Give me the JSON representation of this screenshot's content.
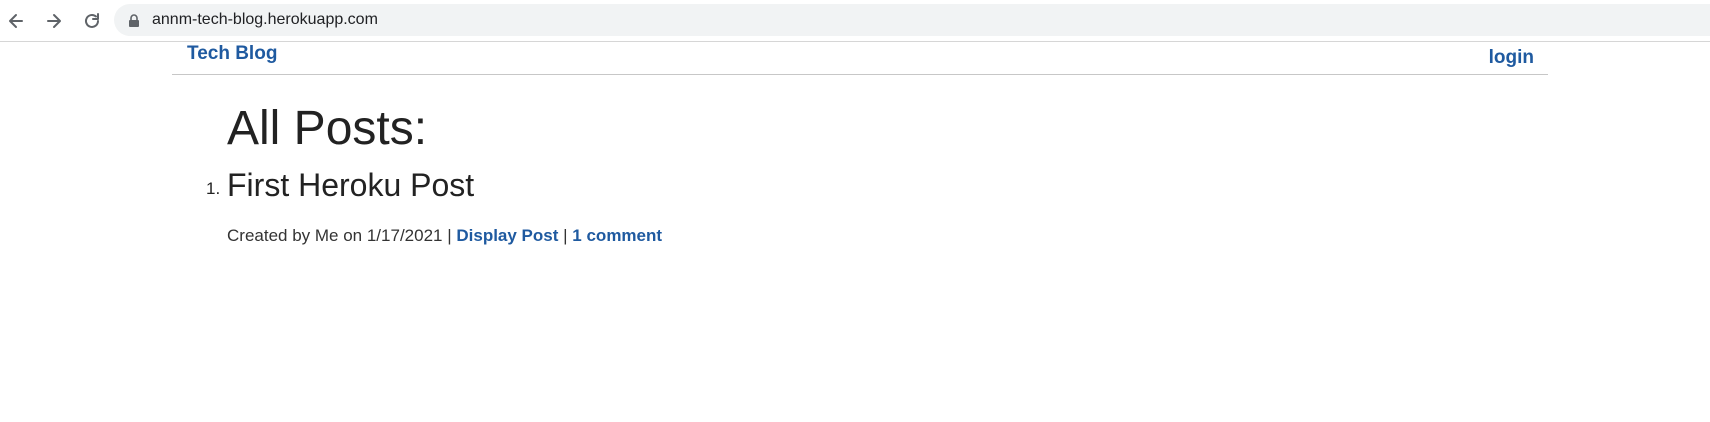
{
  "browser": {
    "url": "annm-tech-blog.herokuapp.com",
    "icons": [
      "back-arrow-icon",
      "forward-arrow-icon",
      "reload-icon",
      "lock-icon"
    ]
  },
  "header": {
    "brand": "Tech Blog",
    "login": "login"
  },
  "main": {
    "title": "All Posts:",
    "posts": [
      {
        "number": "1.",
        "title": "First Heroku Post",
        "meta_prefix": "Created by Me on 1/17/2021 |",
        "display_link": "Display Post",
        "separator": "|",
        "comment_link": "1 comment"
      }
    ]
  },
  "colors": {
    "link": "#1f5aa0",
    "text": "#222222",
    "omnibox": "#f1f3f4"
  }
}
